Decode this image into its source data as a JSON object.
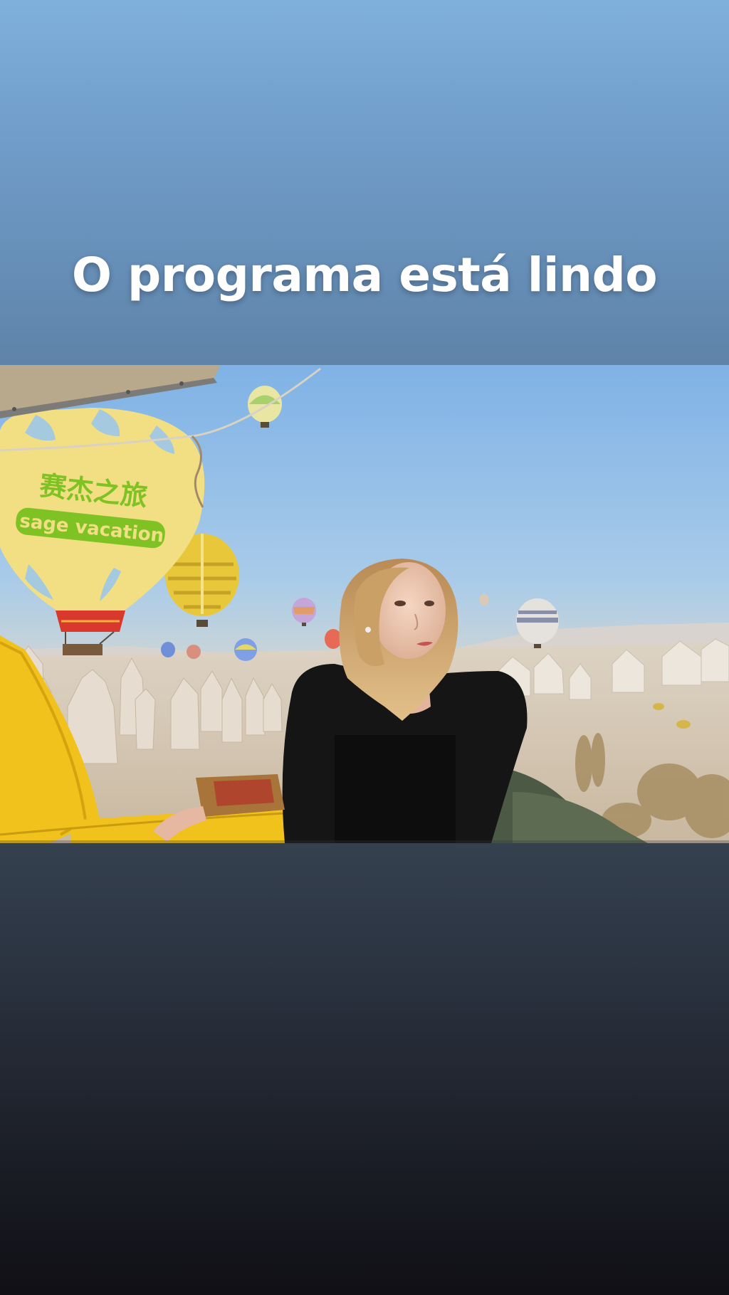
{
  "story": {
    "caption": "O programa está lindo",
    "photo": {
      "balloon_text_cn": "赛杰之旅",
      "balloon_text_en": "sage vacation"
    }
  },
  "colors": {
    "top_background": "#6f9cc8",
    "bottom_background": "#1d2029",
    "caption_text": "#ffffff",
    "balloon_yellow": "#f2df84",
    "balloon_green_text": "#7fc224",
    "basket_yellow": "#f0c21b"
  }
}
